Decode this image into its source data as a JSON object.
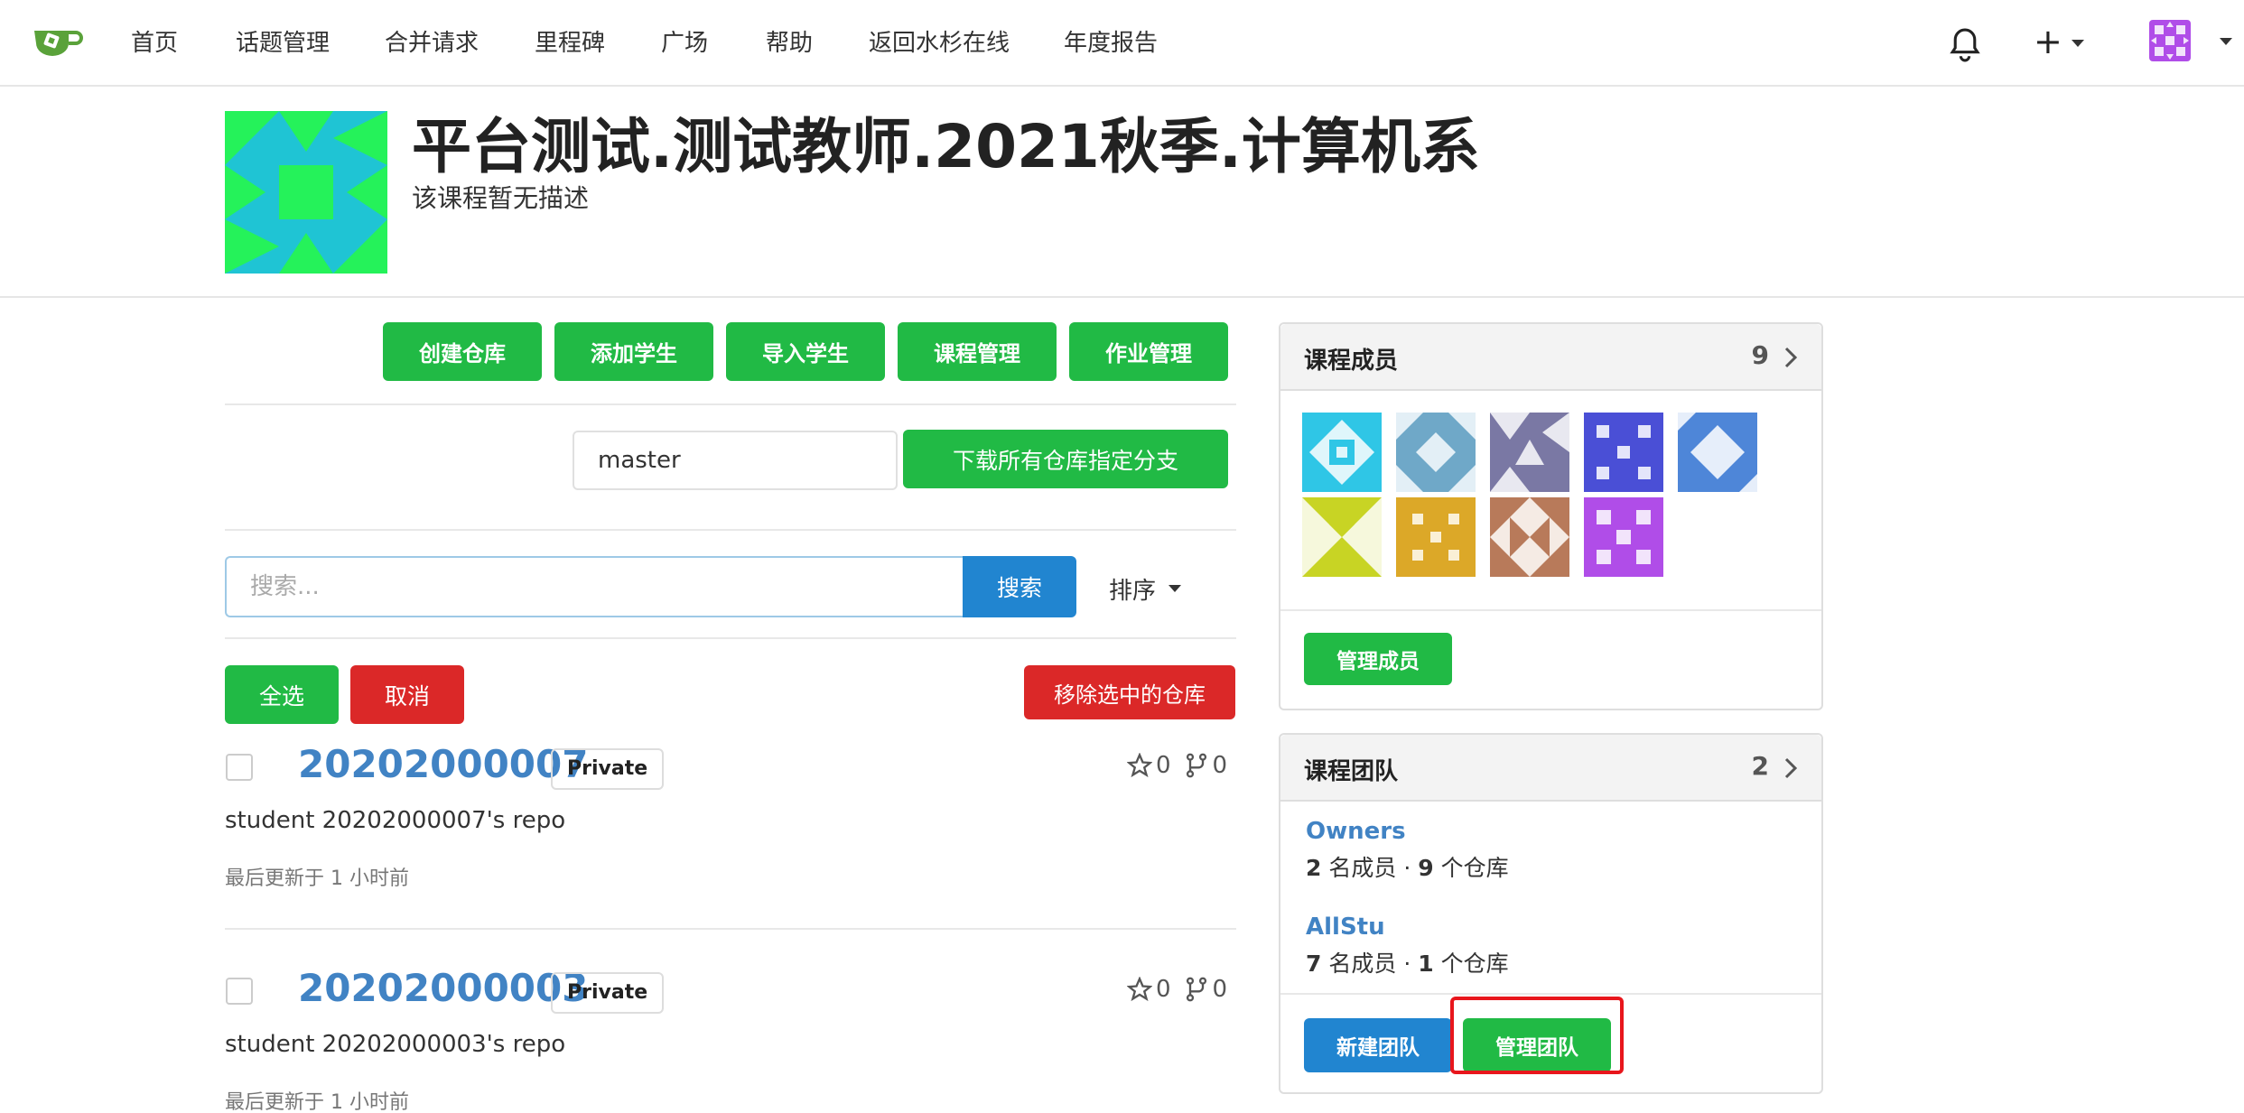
{
  "nav": {
    "items": [
      "首页",
      "话题管理",
      "合并请求",
      "里程碑",
      "广场",
      "帮助",
      "返回水杉在线",
      "年度报告"
    ],
    "plus": "+"
  },
  "header": {
    "title": "平台测试.测试教师.2021秋季.计算机系",
    "description": "该课程暂无描述"
  },
  "actions": {
    "create_repo": "创建仓库",
    "add_student": "添加学生",
    "import_student": "导入学生",
    "course_manage": "课程管理",
    "homework_manage": "作业管理"
  },
  "branch": {
    "value": "master",
    "download_label": "下载所有仓库指定分支"
  },
  "search": {
    "placeholder": "搜索...",
    "button": "搜索",
    "sort": "排序"
  },
  "selection": {
    "select_all": "全选",
    "cancel": "取消",
    "remove_selected": "移除选中的仓库"
  },
  "repos": [
    {
      "name": "20202000007",
      "visibility": "Private",
      "stars": "0",
      "forks": "0",
      "description": "student 20202000007's repo",
      "updated": "最后更新于 1 小时前"
    },
    {
      "name": "20202000003",
      "visibility": "Private",
      "stars": "0",
      "forks": "0",
      "description": "student 20202000003's repo",
      "updated": "最后更新于 1 小时前"
    }
  ],
  "members_card": {
    "title": "课程成员",
    "count": "9",
    "manage_button": "管理成员"
  },
  "teams_card": {
    "title": "课程团队",
    "count": "2",
    "teams": [
      {
        "name": "Owners",
        "members": "2",
        "members_label": "名成员",
        "repos": "9",
        "repos_label": "个仓库"
      },
      {
        "name": "AllStu",
        "members": "7",
        "members_label": "名成员",
        "repos": "1",
        "repos_label": "个仓库"
      }
    ],
    "new_team": "新建团队",
    "manage_team": "管理团队"
  },
  "colors": {
    "green": "#21ba45",
    "blue": "#2185d0",
    "red": "#db2828",
    "link": "#4183c4",
    "highlight": "#e8161c"
  }
}
